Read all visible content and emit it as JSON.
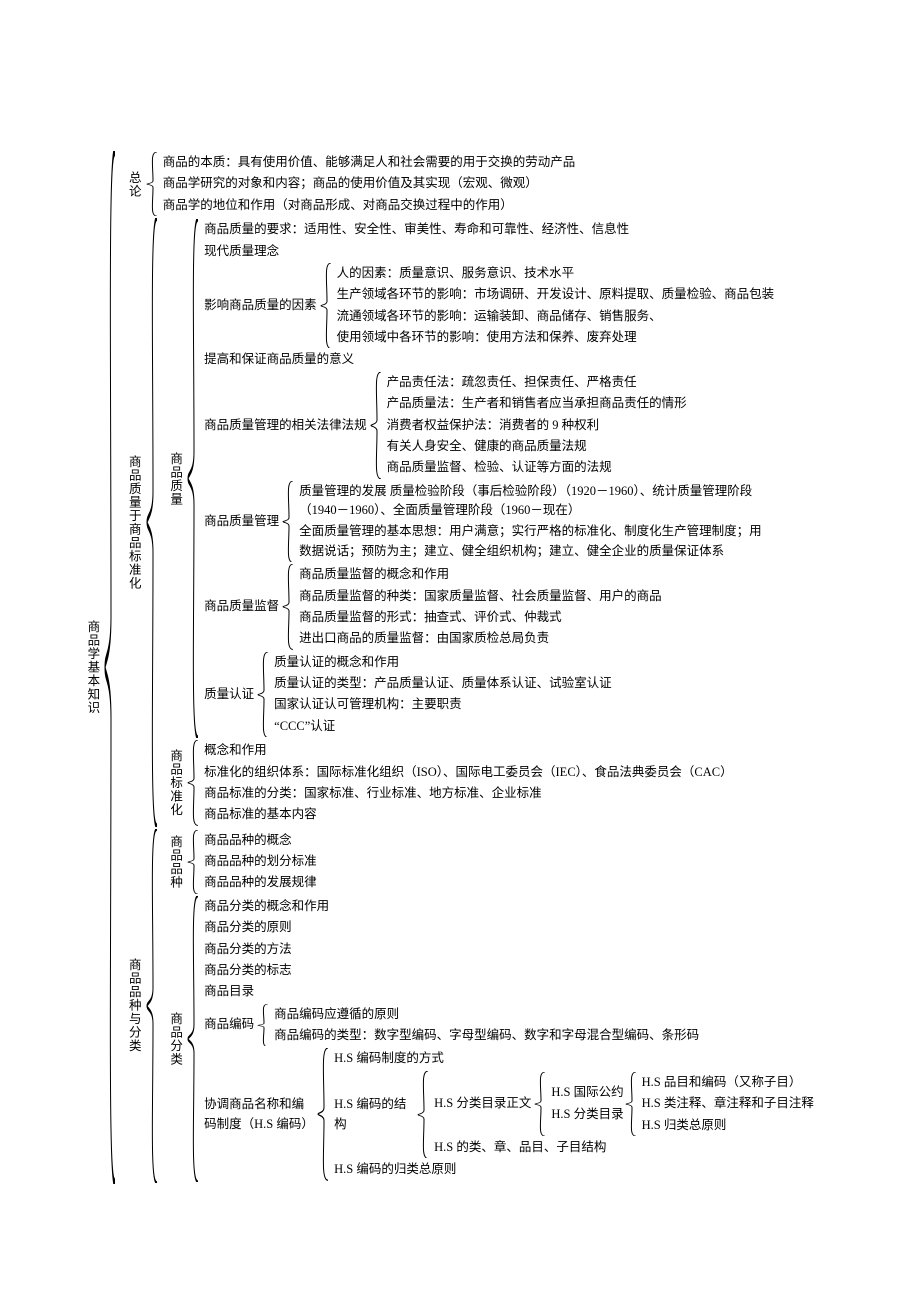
{
  "root": "商品学基本知识",
  "s1": {
    "title": "总论",
    "a": "商品的本质：具有使用价值、能够满足人和社会需要的用于交换的劳动产品",
    "b": "商品学研究的对象和内容；商品的使用价值及其实现（宏观、微观）",
    "c": "商品学的地位和作用（对商品形成、对商品交换过程中的作用）"
  },
  "s2": {
    "title": "商品质量于商品标准化",
    "q": {
      "title": "商品质量",
      "a": "商品质量的要求：适用性、安全性、审美性、寿命和可靠性、经济性、信息性",
      "b": "现代质量理念",
      "fac": {
        "title": "影响商品质量的因素",
        "a": "人的因素：质量意识、服务意识、技术水平",
        "b": "生产领域各环节的影响：市场调研、开发设计、原料提取、质量检验、商品包装",
        "c": "流通领域各环节的影响：运输装卸、商品储存、销售服务、",
        "d": "使用领域中各环节的影响：使用方法和保养、废弃处理"
      },
      "c": "提高和保证商品质量的意义",
      "law": {
        "title": "商品质量管理的相关法律法规",
        "a": "产品责任法：疏忽责任、担保责任、严格责任",
        "b": "产品质量法：生产者和销售者应当承担商品责任的情形",
        "c": "消费者权益保护法：消费者的 9 种权利",
        "d": "有关人身安全、健康的商品质量法规",
        "e": "商品质量监督、检验、认证等方面的法规"
      },
      "mgmt": {
        "title": "商品质量管理",
        "a": "质量管理的发展 质量检验阶段（事后检验阶段）（1920－1960）、统计质量管理阶段（1940－1960）、全面质量管理阶段（1960－现在）",
        "b": "全面质量管理的基本思想：用户满意；实行严格的标准化、制度化生产管理制度；用数据说话；预防为主；建立、健全组织机构；建立、健全企业的质量保证体系"
      },
      "sup": {
        "title": "商品质量监督",
        "a": "商品质量监督的概念和作用",
        "b": "商品质量监督的种类：国家质量监督、社会质量监督、用户的商品",
        "c": "商品质量监督的形式：抽查式、评价式、仲裁式",
        "d": "进出口商品的质量监督：由国家质检总局负责"
      },
      "cert": {
        "title": "质量认证",
        "a": "质量认证的概念和作用",
        "b": "质量认证的类型：产品质量认证、质量体系认证、试验室认证",
        "c": "国家认证认可管理机构：主要职责",
        "d": "“CCC”认证"
      }
    },
    "std": {
      "title": "商品标准化",
      "a": "概念和作用",
      "b": "标准化的组织体系：国际标准化组织（ISO）、国际电工委员会（IEC）、食品法典委员会（CAC）",
      "c": "商品标准的分类：国家标准、行业标准、地方标准、企业标准",
      "d": "商品标准的基本内容"
    }
  },
  "s3": {
    "title": "商品品种与分类",
    "var": {
      "title": "商品品种",
      "a": "商品品种的概念",
      "b": "商品品种的划分标准",
      "c": "商品品种的发展规律"
    },
    "cls": {
      "title": "商品分类",
      "a": "商品分类的概念和作用",
      "b": "商品分类的原则",
      "c": "商品分类的方法",
      "d": "商品分类的标志",
      "e": "商品目录",
      "code": {
        "title": "商品编码",
        "a": "商品编码应遵循的原则",
        "b": "商品编码的类型：数字型编码、字母型编码、数字和字母混合型编码、条形码"
      },
      "hs": {
        "title": "协调商品名称和编码制度（H.S 编码）",
        "sys": "H.S 编码制度的方式",
        "struct": {
          "title": "H.S 编码的结构",
          "cat": {
            "title": "H.S 分类目录正文",
            "a": "H.S 国际公约",
            "b": "H.S 分类目录"
          },
          "sub": "H.S 的类、章、品目、子目结构"
        },
        "detail": {
          "a": "H.S 品目和编码（又称子目）",
          "b": "H.S 类注释、章注释和子目注释",
          "c": "H.S 归类总原则"
        },
        "rule": "H.S 编码的归类总原则"
      }
    }
  }
}
